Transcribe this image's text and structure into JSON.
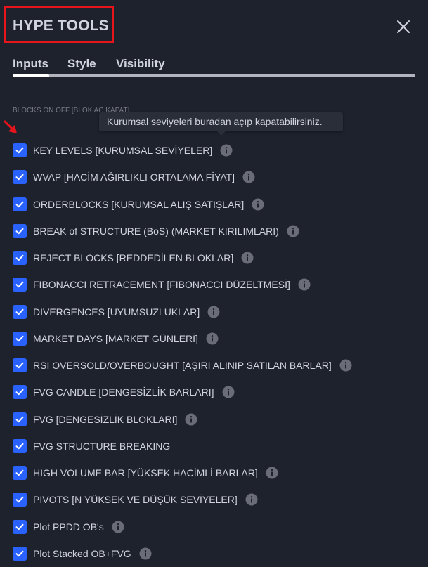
{
  "dialog": {
    "title": "HYPE TOOLS",
    "highlight_color": "#e8141b"
  },
  "tabs": [
    {
      "label": "Inputs",
      "active": true
    },
    {
      "label": "Style",
      "active": false
    },
    {
      "label": "Visibility",
      "active": false
    }
  ],
  "section": {
    "header": "BLOCKS ON OFF [BLOK AÇ KAPAT]"
  },
  "tooltip": {
    "text": "Kurumsal seviyeleri buradan açıp kapatabilirsiniz."
  },
  "colors": {
    "background": "#1e222d",
    "checkbox": "#2962ff",
    "text": "#d1d4dc",
    "muted": "#787b86"
  },
  "items": [
    {
      "label": "KEY LEVELS [KURUMSAL SEVİYELER]",
      "checked": true,
      "info": true
    },
    {
      "label": "WVAP [HACİM AĞIRLIKLI ORTALAMA FİYAT]",
      "checked": true,
      "info": true
    },
    {
      "label": "ORDERBLOCKS [KURUMSAL ALIŞ SATIŞLAR]",
      "checked": true,
      "info": true
    },
    {
      "label": "BREAK of STRUCTURE (BoS) (MARKET KIRILIMLARI)",
      "checked": true,
      "info": true
    },
    {
      "label": "REJECT BLOCKS [REDDEDİLEN BLOKLAR]",
      "checked": true,
      "info": true
    },
    {
      "label": "FIBONACCI RETRACEMENT [FIBONACCI DÜZELTMESİ]",
      "checked": true,
      "info": true
    },
    {
      "label": "DIVERGENCES [UYUMSUZLUKLAR]",
      "checked": true,
      "info": true
    },
    {
      "label": "MARKET DAYS [MARKET GÜNLERİ]",
      "checked": true,
      "info": true
    },
    {
      "label": "RSI OVERSOLD/OVERBOUGHT [AŞIRI ALINIP SATILAN BARLAR]",
      "checked": true,
      "info": true
    },
    {
      "label": "FVG CANDLE [DENGESİZLİK BARLARI]",
      "checked": true,
      "info": true
    },
    {
      "label": "FVG [DENGESİZLİK BLOKLARI]",
      "checked": true,
      "info": true
    },
    {
      "label": "FVG STRUCTURE BREAKING",
      "checked": true,
      "info": false
    },
    {
      "label": "HIGH VOLUME BAR [YÜKSEK HACİMLİ BARLAR]",
      "checked": true,
      "info": true
    },
    {
      "label": "PIVOTS [N YÜKSEK VE DÜŞÜK SEVİYELER]",
      "checked": true,
      "info": true
    },
    {
      "label": "Plot PPDD OB's",
      "checked": true,
      "info": true
    },
    {
      "label": "Plot Stacked OB+FVG",
      "checked": true,
      "info": true
    }
  ]
}
